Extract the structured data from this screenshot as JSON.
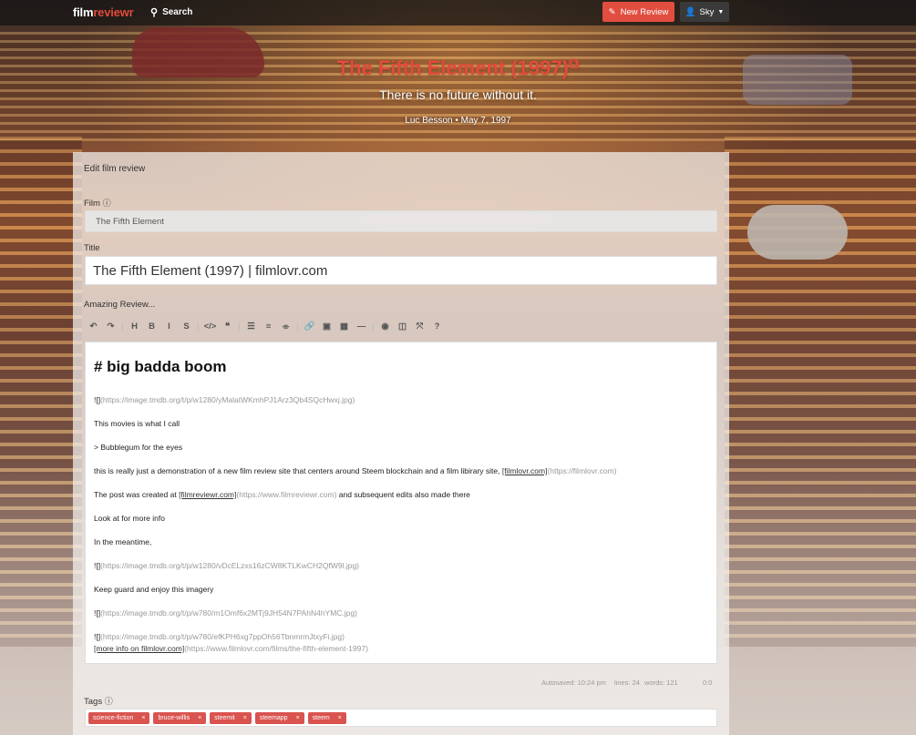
{
  "navbar": {
    "brand_film": "film",
    "brand_reviewr": "reviewr",
    "search_label": "Search",
    "new_review_label": "New Review",
    "user_label": "Sky"
  },
  "hero": {
    "title": "The Fifth Element (1997)",
    "tagline": "There is no future without it.",
    "meta": "Luc Besson • May 7, 1997"
  },
  "form": {
    "heading": "Edit film review",
    "film_label": "Film",
    "film_value": "The Fifth Element",
    "title_label": "Title",
    "title_value": "The Fifth Element (1997) | filmlovr.com",
    "review_label": "Amazing Review..."
  },
  "toolbar": [
    {
      "icon": "undo-icon",
      "glyph": "↶"
    },
    {
      "icon": "redo-icon",
      "glyph": "↷"
    },
    {
      "icon": "heading-icon",
      "glyph": "H"
    },
    {
      "icon": "bold-icon",
      "glyph": "B"
    },
    {
      "icon": "italic-icon",
      "glyph": "I"
    },
    {
      "icon": "strikethrough-icon",
      "glyph": "S"
    },
    {
      "icon": "code-icon",
      "glyph": "</>"
    },
    {
      "icon": "quote-icon",
      "glyph": "❝"
    },
    {
      "icon": "unordered-list-icon",
      "glyph": "☰"
    },
    {
      "icon": "ordered-list-icon",
      "glyph": "≡"
    },
    {
      "icon": "clean-block-icon",
      "glyph": "⌯"
    },
    {
      "icon": "link-icon",
      "glyph": "🔗"
    },
    {
      "icon": "image-icon",
      "glyph": "▣"
    },
    {
      "icon": "table-icon",
      "glyph": "▦"
    },
    {
      "icon": "horizontal-rule-icon",
      "glyph": "—"
    },
    {
      "icon": "preview-icon",
      "glyph": "◉"
    },
    {
      "icon": "side-by-side-icon",
      "glyph": "◫"
    },
    {
      "icon": "fullscreen-icon",
      "glyph": "⤧"
    },
    {
      "icon": "help-icon",
      "glyph": "?"
    }
  ],
  "editor": {
    "heading": "# big badda boom",
    "img1_bang": "![]",
    "img1_url": "(https://image.tmdb.org/t/p/w1280/yMalatWKmhPJ1Arz3Qb4SQcHwxj.jpg)",
    "line_call": "This movies is what I call",
    "line_quote": "> Bubblegum for the eyes",
    "line_demo_pre": "this is really just a demonstration of a new film review site that centers around Steem blockchain and a film libirary site, ",
    "line_demo_link": "[filmlovr.com]",
    "line_demo_url": "(https://filmlovr.com)",
    "line_post_pre": "The post was created at ",
    "line_post_link": "[filmreviewr.com]",
    "line_post_url": "(https://www.filmreviewr.com)",
    "line_post_post": " and subsequent edits also made there",
    "line_look": "Look at for more info",
    "line_meantime": "In the meantime,",
    "img2_bang": "![]",
    "img2_url": "(https://image.tmdb.org/t/p/w1280/vDcELzxs16zCW8KTLKwCH2QfW9l.jpg)",
    "line_guard": "Keep guard and enjoy this imagery",
    "img3_bang": "![]",
    "img3_url": "(https://image.tmdb.org/t/p/w780/m1Omf6x2MTj9JH54N7PAhN4hYMC.jpg)",
    "img4_bang": "![]",
    "img4_url": "(https://image.tmdb.org/t/p/w780/efKPH6xg7ppOh56TbnmrmJtxyFi.jpg)",
    "more_link": "[more info on filmlovr.com]",
    "more_url": "(https://www.filmlovr.com/films/the-fifth-element-1997)"
  },
  "status": {
    "autosaved": "Autosaved: 10:24 pm",
    "lines": "lines: 24",
    "words": "words: 121",
    "cursor": "0:0"
  },
  "tags": {
    "label": "Tags",
    "items": [
      "science-fiction",
      "bruce-willis",
      "steemit",
      "steemapp",
      "steem"
    ],
    "remove_glyph": "×"
  },
  "colors": {
    "accent": "#e14e40",
    "tag": "#d9534f"
  }
}
